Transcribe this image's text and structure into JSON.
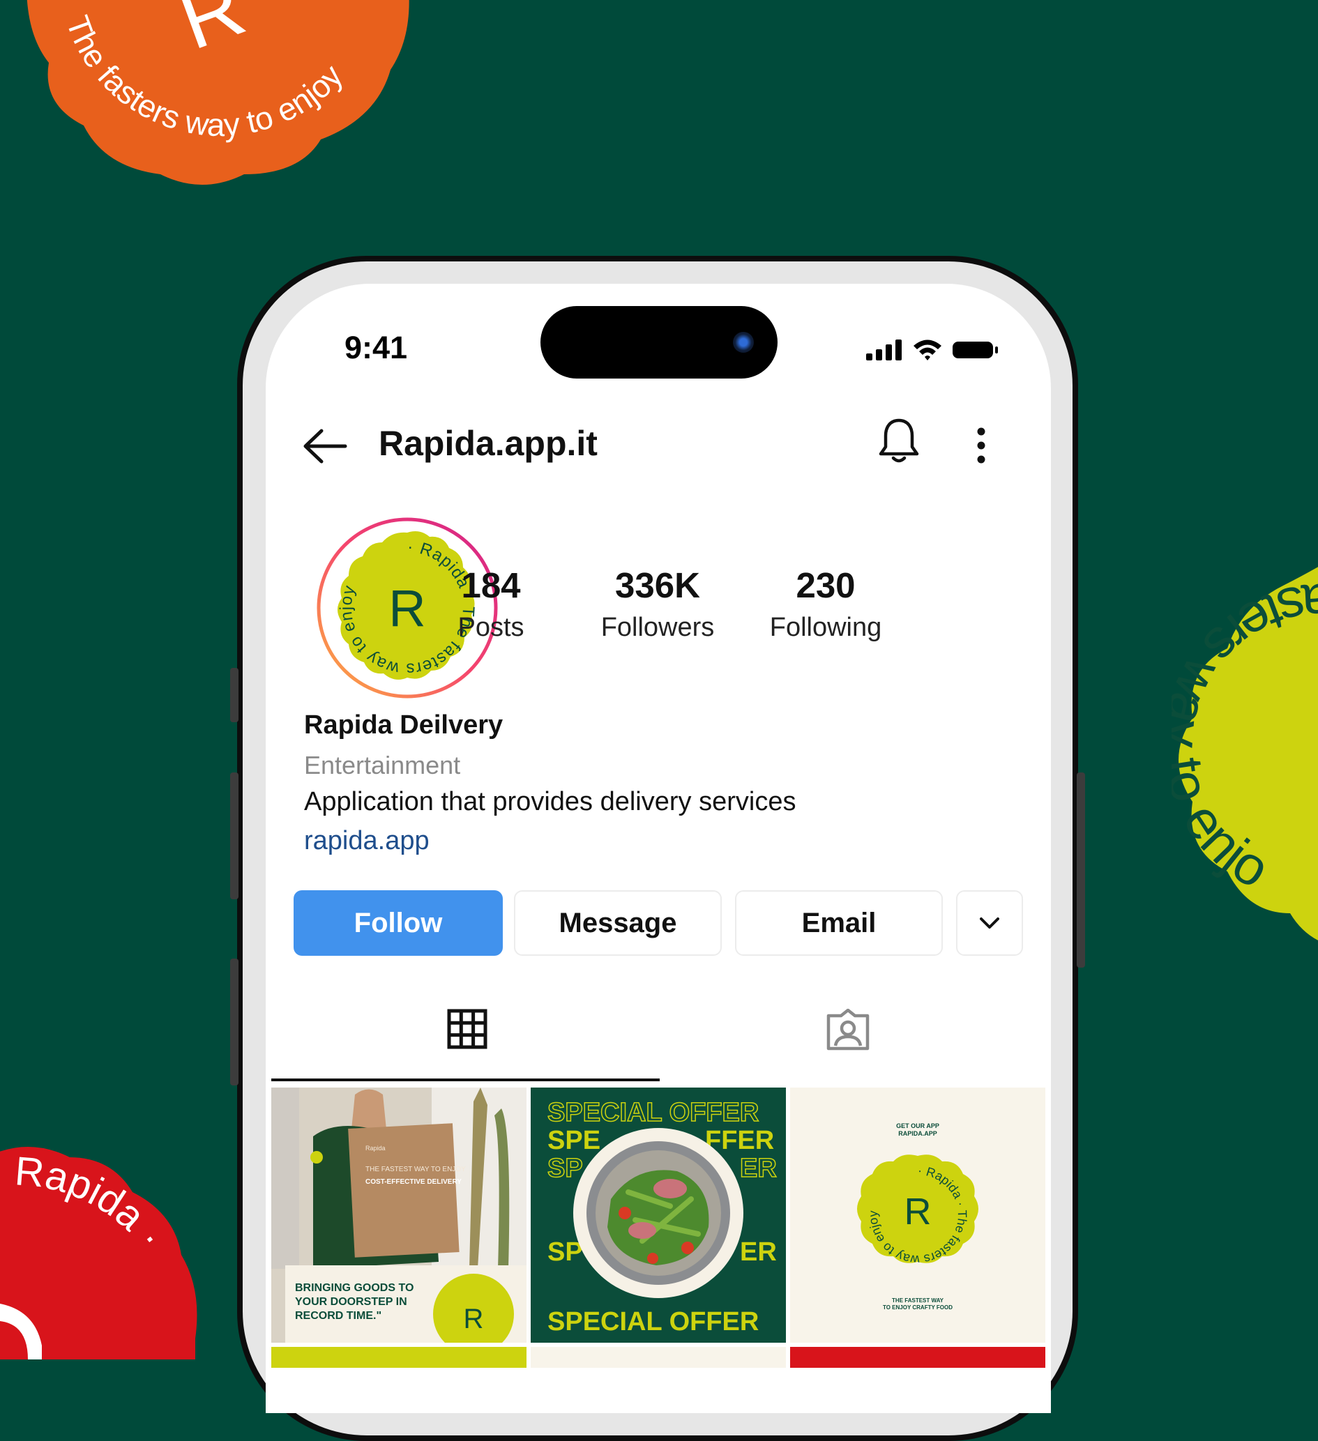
{
  "colors": {
    "background": "#004a3a",
    "accent_blue": "#4192ed",
    "brand_lime": "#cdd30f",
    "brand_green": "#0b4d3a",
    "badge_orange": "#e8601c",
    "badge_red": "#d8141b"
  },
  "decor": {
    "badge_orange_text": "The fasters way to enjoy",
    "badge_orange_letter": "R",
    "badge_lime_text": "fasters way to enjoy",
    "badge_red_text": "Rapida ·"
  },
  "status_bar": {
    "time": "9:41",
    "icons": [
      "signal-icon",
      "wifi-icon",
      "battery-icon"
    ]
  },
  "nav": {
    "title": "Rapida.app.it",
    "icons": [
      "back-arrow-icon",
      "bell-icon",
      "more-vertical-icon"
    ]
  },
  "profile": {
    "avatar_letter": "R",
    "avatar_ring_text": "· Rapida · The fasters way to enjoy",
    "stats": [
      {
        "value": "184",
        "label": "Posts"
      },
      {
        "value": "336K",
        "label": "Followers"
      },
      {
        "value": "230",
        "label": "Following"
      }
    ],
    "name": "Rapida Deilvery",
    "category": "Entertainment",
    "bio": "Application that provides delivery services",
    "link": "rapida.app"
  },
  "actions": {
    "follow": "Follow",
    "message": "Message",
    "email": "Email"
  },
  "tabs": [
    {
      "icon": "grid-icon",
      "active": true
    },
    {
      "icon": "tagged-user-icon",
      "active": false
    }
  ],
  "posts": [
    {
      "box_brand": "Rapida",
      "box_text": "THE FASTEST WAY TO ENJOY",
      "box_text_bold": "COST-EFFECTIVE DELIVERY",
      "caption": "BRINGING GOODS TO YOUR DOORSTEP IN RECORD TIME.\"",
      "stamp_letter": "R"
    },
    {
      "repeat_text": "SPECIAL OFFER",
      "partial_lines": [
        "SPE",
        "FFER",
        "SP",
        "ER",
        "SP",
        "ER"
      ]
    },
    {
      "top_text_1": "GET OUR APP",
      "top_text_2": "RAPIDA.APP",
      "seal_letter": "R",
      "seal_text": "· Rapida · The fasters way to enjoy",
      "bottom_text_1": "THE FASTEST WAY",
      "bottom_text_2": "TO ENJOY CRAFTY FOOD"
    }
  ]
}
